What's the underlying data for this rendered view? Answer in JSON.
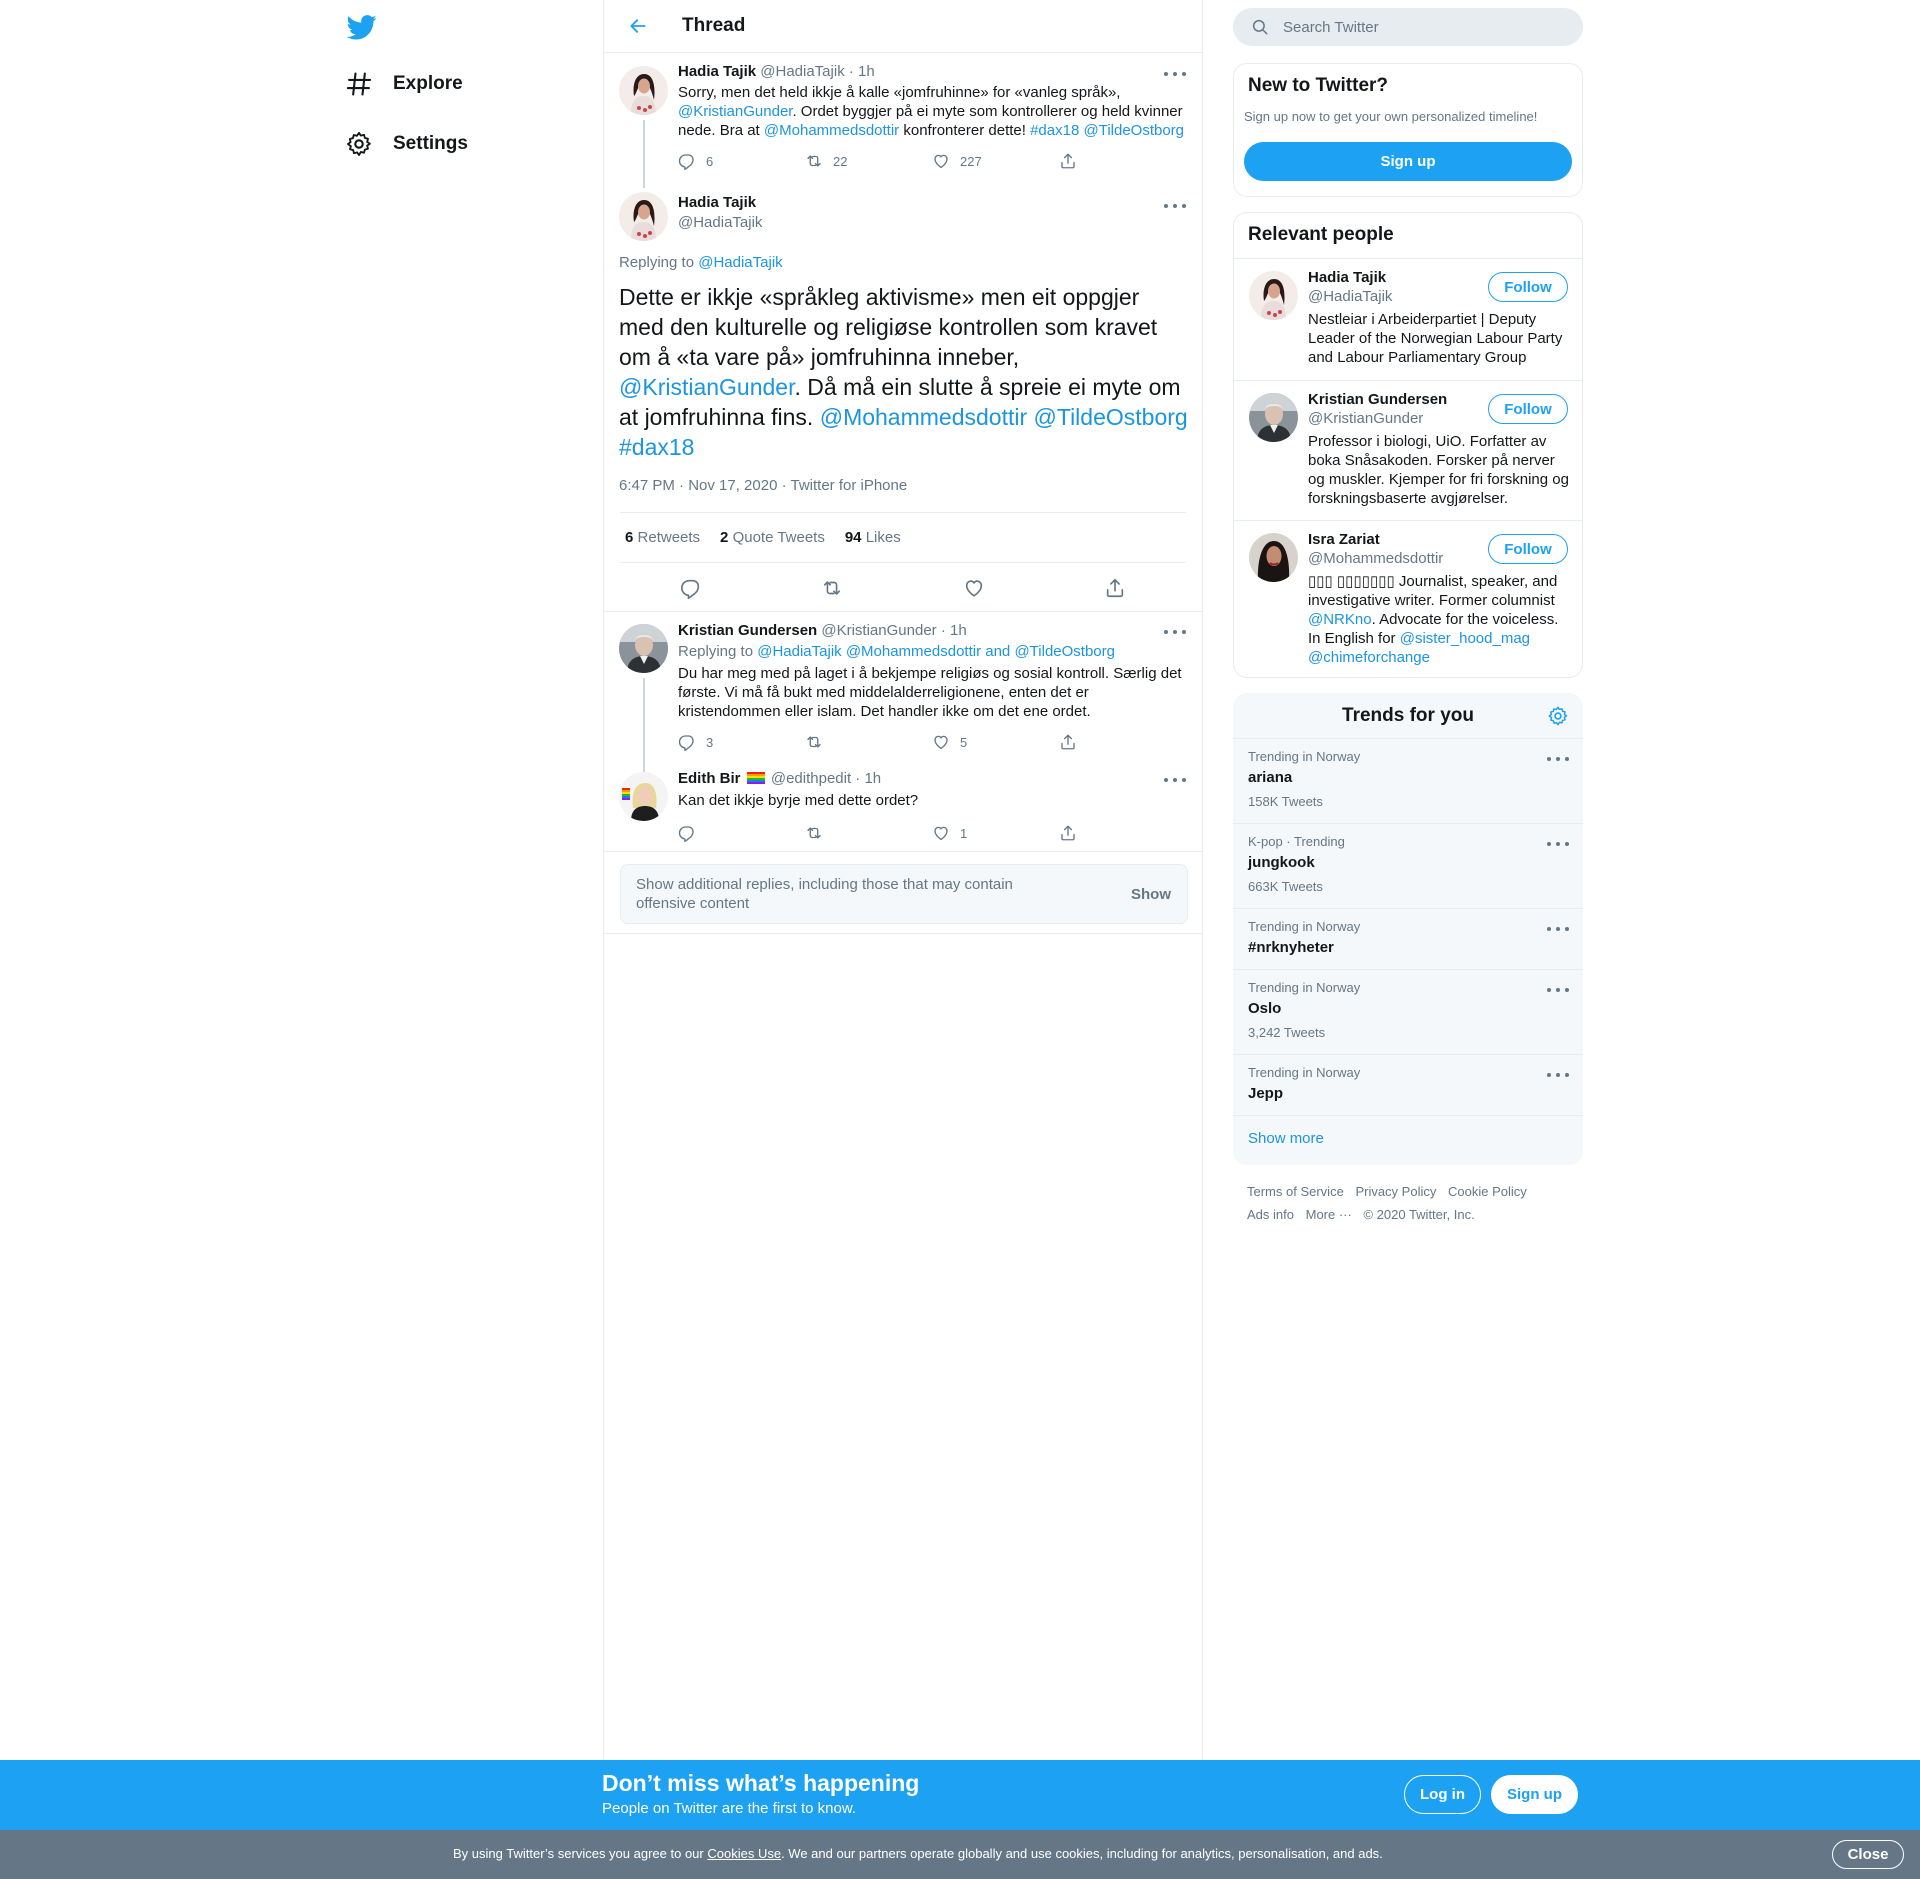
{
  "nav": {
    "explore": "Explore",
    "settings": "Settings"
  },
  "header": {
    "title": "Thread"
  },
  "tweets": {
    "t1": {
      "name": "Hadia Tajik",
      "handle": "@HadiaTajik",
      "time": "· 1h",
      "text_a": "Sorry, men det held ikkje å kalle «jomfruhinne» for «vanleg språk», ",
      "mention1": "@KristianGunder",
      "text_b": ". Ordet byggjer på ei myte som kontrollerer og held kvinner nede. Bra at ",
      "mention2": "@Mohammedsdottir",
      "text_c": " konfronterer dette! ",
      "hashtag": "#dax18",
      "mention3": "@TildeOstborg",
      "replies": "6",
      "retweets": "22",
      "likes": "227"
    },
    "focus": {
      "name": "Hadia Tajik",
      "handle": "@HadiaTajik",
      "replying_prefix": "Replying to ",
      "replying_to": "@HadiaTajik",
      "text_a": "Dette er ikkje «språkleg aktivisme» men eit oppgjer med den kulturelle og religiøse kontrollen som kravet om å «ta vare på» jomfruhinna inneber, ",
      "mention1": "@KristianGunder",
      "text_b": ". Då må ein slutte å spreie ei myte om at jomfruhinna fins. ",
      "mention2": "@Mohammedsdottir",
      "mention3": "@TildeOstborg",
      "hashtag": "#dax18",
      "meta": "6:47 PM · Nov 17, 2020 · Twitter for iPhone",
      "retweets_count": "6",
      "retweets_label": "Retweets",
      "quotes_count": "2",
      "quotes_label": "Quote Tweets",
      "likes_count": "94",
      "likes_label": "Likes"
    },
    "t3": {
      "name": "Kristian Gundersen",
      "handle": "@KristianGunder",
      "time": "· 1h",
      "replying_prefix": "Replying to ",
      "replying_to": "@HadiaTajik @Mohammedsdottir and @TildeOstborg",
      "text": "Du har meg med på laget i å bekjempe religiøs og sosial kontroll. Særlig det første. Vi må få bukt med middelalderreligionene, enten det er kristendommen eller islam. Det handler ikke om det ene ordet.",
      "replies": "3",
      "retweets": "",
      "likes": "5"
    },
    "t4": {
      "name": "Edith Bir",
      "handle": "@edithpedit",
      "time": "· 1h",
      "text": "Kan det ikkje byrje med dette ordet?",
      "replies": "",
      "retweets": "",
      "likes": "1"
    }
  },
  "more_replies": {
    "text": "Show additional replies, including those that may contain offensive content",
    "button": "Show"
  },
  "search": {
    "placeholder": "Search Twitter"
  },
  "new_to_twitter": {
    "title": "New to Twitter?",
    "subtitle": "Sign up now to get your own personalized timeline!",
    "button": "Sign up"
  },
  "relevant": {
    "title": "Relevant people",
    "follow_label": "Follow",
    "people": [
      {
        "name": "Hadia Tajik",
        "handle": "@HadiaTajik",
        "bio": "Nestleiar i Arbeiderpartiet | Deputy Leader of the Norwegian Labour Party and Labour Parliamentary Group"
      },
      {
        "name": "Kristian Gundersen",
        "handle": "@KristianGunder",
        "bio": "Professor i biologi, UiO. Forfatter av boka Snåsakoden. Forsker på nerver og muskler. Kjemper for fri forskning og forskningsbaserte avgjørelser."
      },
      {
        "name": "Isra Zariat",
        "handle": "@Mohammedsdottir",
        "bio_a": "▯▯▯ ▯▯▯▯▯▯▯ Journalist, speaker, and investigative writer. Former columnist ",
        "bio_link1": "@NRKno",
        "bio_b": ". Advocate for the voiceless. In English for ",
        "bio_link2": "@sister_hood_mag",
        "bio_link3": "@chimeforchange"
      }
    ]
  },
  "trends": {
    "title": "Trends for you",
    "items": [
      {
        "context": "Trending in Norway",
        "name": "ariana",
        "count": "158K Tweets"
      },
      {
        "context": "K-pop · Trending",
        "name": "jungkook",
        "count": "663K Tweets"
      },
      {
        "context": "Trending in Norway",
        "name": "#nrknyheter",
        "count": ""
      },
      {
        "context": "Trending in Norway",
        "name": "Oslo",
        "count": "3,242 Tweets"
      },
      {
        "context": "Trending in Norway",
        "name": "Jepp",
        "count": ""
      }
    ],
    "show_more": "Show more"
  },
  "footer": {
    "terms": "Terms of Service",
    "privacy": "Privacy Policy",
    "cookie": "Cookie Policy",
    "ads": "Ads info",
    "more": "More ···",
    "copyright": "© 2020 Twitter, Inc."
  },
  "banner": {
    "title": "Don’t miss what’s happening",
    "subtitle": "People on Twitter are the first to know.",
    "login": "Log in",
    "signup": "Sign up"
  },
  "cookie": {
    "text_a": "By using Twitter’s services you agree to our ",
    "link": "Cookies Use",
    "text_b": ". We and our partners operate globally and use cookies, including for analytics, personalisation, and ads.",
    "close": "Close"
  },
  "colors": {
    "brand": "#1da1f2",
    "link": "#1b95e0",
    "muted": "#657786",
    "border": "#e6ecf0"
  },
  "icons": [
    "twitter-logo-icon",
    "hashtag-icon",
    "gear-icon",
    "back-arrow-icon",
    "search-icon",
    "reply-icon",
    "retweet-icon",
    "like-icon",
    "share-icon",
    "more-dots-icon"
  ]
}
